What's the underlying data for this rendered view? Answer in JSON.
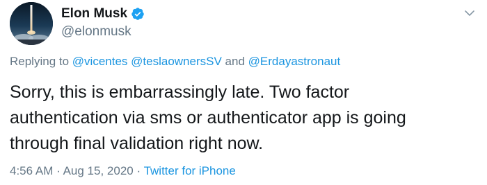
{
  "author": {
    "display_name": "Elon Musk",
    "handle": "@elonmusk",
    "verified": true,
    "avatar_icon": "rocket-launch-avatar"
  },
  "menu": {
    "icon": "chevron-down-icon"
  },
  "reply": {
    "prefix": "Replying to",
    "mention_1": "@vicentes",
    "mention_2": "@teslaownersSV",
    "joiner": "and",
    "mention_3": "@Erdayastronaut"
  },
  "tweet": {
    "lines": [
      "Sorry, this is embarrassingly late. Two factor",
      "authentication via sms or authenticator app is going",
      "through final validation right now."
    ]
  },
  "meta": {
    "time": "4:56 AM",
    "separator": "·",
    "date": "Aug 15, 2020",
    "source": "Twitter for iPhone"
  },
  "colors": {
    "link": "#1b95e0",
    "secondary_text": "#657786",
    "primary_text": "#14171a",
    "verified_badge": "#1da1f2"
  }
}
